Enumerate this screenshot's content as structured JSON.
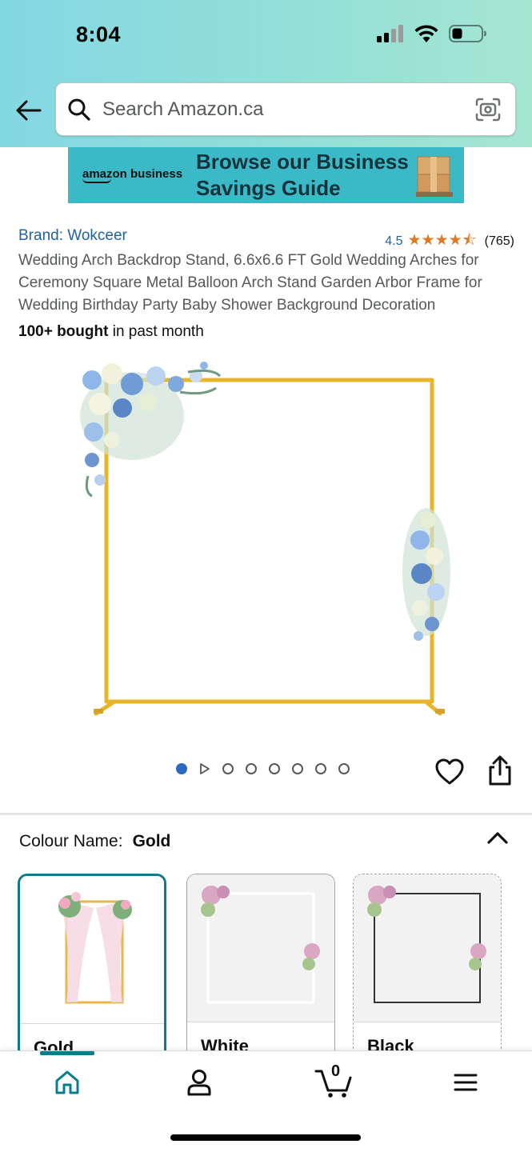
{
  "status_bar": {
    "time": "8:04",
    "icons": [
      "cellular-signal-icon",
      "wifi-icon",
      "battery-icon"
    ]
  },
  "header": {
    "back_icon": "back-arrow-icon",
    "search": {
      "placeholder": "Search Amazon.ca",
      "icon": "search-icon",
      "camera_icon": "camera-scan-icon"
    }
  },
  "banner": {
    "logo_text": "amazon business",
    "headline_line1": "Browse our Business",
    "headline_line2": "Savings Guide",
    "bg_color": "#3bb9c6"
  },
  "product": {
    "brand": "Brand: Wokceer",
    "rating": "4.5",
    "stars": "★★★★⯪",
    "review_count": "(765)",
    "title": "Wedding Arch Backdrop Stand, 6.6x6.6 FT Gold Wedding Arches for Ceremony Square Metal Balloon Arch Stand Garden Arbor Frame for Wedding Birthday Party Baby Shower Background Decoration",
    "bought_bold": "100+ bought",
    "bought_rest": " in past month",
    "image_carousel": {
      "total_items": 8,
      "active_index": 0,
      "video_item_index": 1
    },
    "colors": {
      "star": "#de7921",
      "link": "#2162a1",
      "frame_gold": "#e8b52a"
    }
  },
  "colour_selector": {
    "label": "Colour Name:",
    "selected_value": "Gold",
    "options": [
      {
        "label": "Gold",
        "selected": true
      },
      {
        "label": "White",
        "selected": false
      },
      {
        "label": "Black",
        "selected": false
      }
    ]
  },
  "bottom_nav": {
    "items": [
      "home-icon",
      "account-icon",
      "cart-icon",
      "menu-icon"
    ],
    "cart_count": "0",
    "accent": "#087d8c"
  }
}
